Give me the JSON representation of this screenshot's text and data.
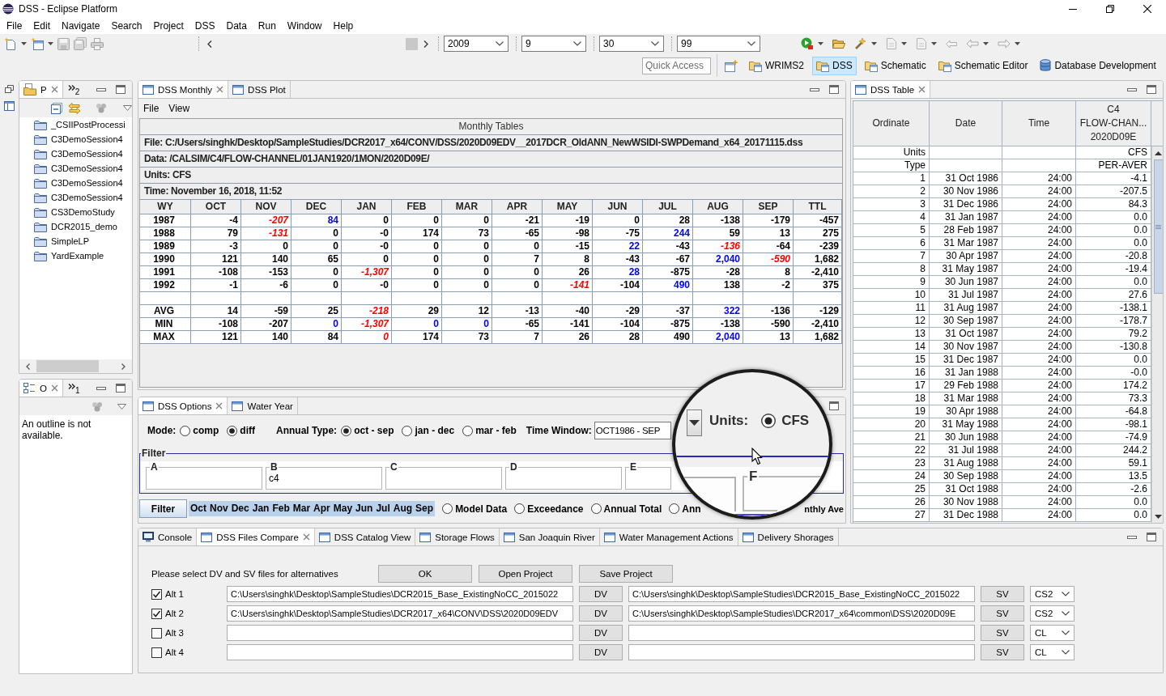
{
  "window": {
    "title": "DSS - Eclipse Platform"
  },
  "menu": [
    "File",
    "Edit",
    "Navigate",
    "Search",
    "Project",
    "DSS",
    "Data",
    "Run",
    "Window",
    "Help"
  ],
  "toolbar": {
    "combos": [
      "2009",
      "9",
      "30",
      "99"
    ],
    "quick_access": {
      "placeholder": "Quick Access"
    },
    "perspectives": [
      {
        "label": "WRIMS2",
        "kind": "folder",
        "selected": false
      },
      {
        "label": "DSS",
        "kind": "folder",
        "selected": true
      },
      {
        "label": "Schematic",
        "kind": "folder",
        "selected": false
      },
      {
        "label": "Schematic Editor",
        "kind": "folder",
        "selected": false
      },
      {
        "label": "Database Development",
        "kind": "database",
        "selected": false
      }
    ]
  },
  "project_explorer": {
    "tabs": [
      {
        "label": "P",
        "kind": "project",
        "selected": true
      }
    ],
    "overflow": "2",
    "items": [
      "_CSIIPostProcessi",
      "C3DemoSession4",
      "C3DemoSession4",
      "C3DemoSession4",
      "C3DemoSession4",
      "C3DemoSession4",
      "CS3DemoStudy",
      "DCR2015_demo",
      "SimpleLP",
      "YardExample"
    ]
  },
  "outline": {
    "tabs": [
      {
        "label": "O",
        "kind": "outline",
        "selected": true
      }
    ],
    "overflow": "1",
    "message": "An outline is not available."
  },
  "monthly": {
    "tabs": [
      {
        "label": "DSS Monthly",
        "kind": "view",
        "selected": true
      },
      {
        "label": "DSS Plot",
        "kind": "view",
        "selected": false
      }
    ],
    "menu": [
      "File",
      "View"
    ],
    "caption": "Monthly Tables",
    "info": [
      "File: C:/Users/singhk/Desktop/SampleStudies/DCR2017_x64/CONV/DSS/2020D09EDV__2017DCR_OldANN_NewWSIDI-SWPDemand_x64_20171115.dss",
      "Data: /CALSIM/C4/FLOW-CHANNEL/01JAN1920/1MON/2020D09E/",
      "Units: CFS",
      "Time: November 16, 2018, 11:52"
    ],
    "columns": [
      "WY",
      "OCT",
      "NOV",
      "DEC",
      "JAN",
      "FEB",
      "MAR",
      "APR",
      "MAY",
      "JUN",
      "JUL",
      "AUG",
      "SEP",
      "TTL"
    ],
    "rows": [
      {
        "kind": "values",
        "label": "1987",
        "cells": [
          {
            "text": "-4",
            "kind": "plain"
          },
          {
            "text": "-207",
            "kind": "low"
          },
          {
            "text": "84",
            "kind": "high"
          },
          {
            "text": "0",
            "kind": "plain"
          },
          {
            "text": "0",
            "kind": "plain"
          },
          {
            "text": "0",
            "kind": "plain"
          },
          {
            "text": "-21",
            "kind": "plain"
          },
          {
            "text": "-19",
            "kind": "plain"
          },
          {
            "text": "0",
            "kind": "plain"
          },
          {
            "text": "28",
            "kind": "plain"
          },
          {
            "text": "-138",
            "kind": "plain"
          },
          {
            "text": "-179",
            "kind": "plain"
          },
          {
            "text": "-457",
            "kind": "plain"
          }
        ]
      },
      {
        "kind": "values",
        "label": "1988",
        "cells": [
          {
            "text": "79",
            "kind": "plain"
          },
          {
            "text": "-131",
            "kind": "low"
          },
          {
            "text": "0",
            "kind": "plain"
          },
          {
            "text": "-0",
            "kind": "plain"
          },
          {
            "text": "174",
            "kind": "plain"
          },
          {
            "text": "73",
            "kind": "plain"
          },
          {
            "text": "-65",
            "kind": "plain"
          },
          {
            "text": "-98",
            "kind": "plain"
          },
          {
            "text": "-75",
            "kind": "plain"
          },
          {
            "text": "244",
            "kind": "high"
          },
          {
            "text": "59",
            "kind": "plain"
          },
          {
            "text": "13",
            "kind": "plain"
          },
          {
            "text": "275",
            "kind": "plain"
          }
        ]
      },
      {
        "kind": "values",
        "label": "1989",
        "cells": [
          {
            "text": "-3",
            "kind": "plain"
          },
          {
            "text": "0",
            "kind": "plain"
          },
          {
            "text": "0",
            "kind": "plain"
          },
          {
            "text": "-0",
            "kind": "plain"
          },
          {
            "text": "0",
            "kind": "plain"
          },
          {
            "text": "0",
            "kind": "plain"
          },
          {
            "text": "0",
            "kind": "plain"
          },
          {
            "text": "-15",
            "kind": "plain"
          },
          {
            "text": "22",
            "kind": "high"
          },
          {
            "text": "-43",
            "kind": "plain"
          },
          {
            "text": "-136",
            "kind": "low"
          },
          {
            "text": "-64",
            "kind": "plain"
          },
          {
            "text": "-239",
            "kind": "plain"
          }
        ]
      },
      {
        "kind": "values",
        "label": "1990",
        "cells": [
          {
            "text": "121",
            "kind": "plain"
          },
          {
            "text": "140",
            "kind": "plain"
          },
          {
            "text": "65",
            "kind": "plain"
          },
          {
            "text": "0",
            "kind": "plain"
          },
          {
            "text": "0",
            "kind": "plain"
          },
          {
            "text": "0",
            "kind": "plain"
          },
          {
            "text": "7",
            "kind": "plain"
          },
          {
            "text": "8",
            "kind": "plain"
          },
          {
            "text": "-43",
            "kind": "plain"
          },
          {
            "text": "-67",
            "kind": "plain"
          },
          {
            "text": "2,040",
            "kind": "high"
          },
          {
            "text": "-590",
            "kind": "low"
          },
          {
            "text": "1,682",
            "kind": "plain"
          }
        ]
      },
      {
        "kind": "values",
        "label": "1991",
        "cells": [
          {
            "text": "-108",
            "kind": "plain"
          },
          {
            "text": "-153",
            "kind": "plain"
          },
          {
            "text": "0",
            "kind": "plain"
          },
          {
            "text": "-1,307",
            "kind": "low"
          },
          {
            "text": "0",
            "kind": "plain"
          },
          {
            "text": "0",
            "kind": "plain"
          },
          {
            "text": "0",
            "kind": "plain"
          },
          {
            "text": "26",
            "kind": "plain"
          },
          {
            "text": "28",
            "kind": "high"
          },
          {
            "text": "-875",
            "kind": "plain"
          },
          {
            "text": "-28",
            "kind": "plain"
          },
          {
            "text": "8",
            "kind": "plain"
          },
          {
            "text": "-2,410",
            "kind": "plain"
          }
        ]
      },
      {
        "kind": "values",
        "label": "1992",
        "cells": [
          {
            "text": "-1",
            "kind": "plain"
          },
          {
            "text": "-6",
            "kind": "plain"
          },
          {
            "text": "0",
            "kind": "plain"
          },
          {
            "text": "-0",
            "kind": "plain"
          },
          {
            "text": "0",
            "kind": "plain"
          },
          {
            "text": "0",
            "kind": "plain"
          },
          {
            "text": "0",
            "kind": "plain"
          },
          {
            "text": "-141",
            "kind": "low"
          },
          {
            "text": "-104",
            "kind": "plain"
          },
          {
            "text": "490",
            "kind": "high"
          },
          {
            "text": "138",
            "kind": "plain"
          },
          {
            "text": "-2",
            "kind": "plain"
          },
          {
            "text": "375",
            "kind": "plain"
          }
        ]
      },
      {
        "kind": "spacer"
      },
      {
        "kind": "values",
        "label": "AVG",
        "cells": [
          {
            "text": "14",
            "kind": "plain"
          },
          {
            "text": "-59",
            "kind": "plain"
          },
          {
            "text": "25",
            "kind": "plain"
          },
          {
            "text": "-218",
            "kind": "low"
          },
          {
            "text": "29",
            "kind": "plain"
          },
          {
            "text": "12",
            "kind": "plain"
          },
          {
            "text": "-13",
            "kind": "plain"
          },
          {
            "text": "-40",
            "kind": "plain"
          },
          {
            "text": "-29",
            "kind": "plain"
          },
          {
            "text": "-37",
            "kind": "plain"
          },
          {
            "text": "322",
            "kind": "high"
          },
          {
            "text": "-136",
            "kind": "plain"
          },
          {
            "text": "-129",
            "kind": "plain"
          }
        ]
      },
      {
        "kind": "values",
        "label": "MIN",
        "cells": [
          {
            "text": "-108",
            "kind": "plain"
          },
          {
            "text": "-207",
            "kind": "plain"
          },
          {
            "text": "0",
            "kind": "high"
          },
          {
            "text": "-1,307",
            "kind": "low"
          },
          {
            "text": "0",
            "kind": "high"
          },
          {
            "text": "0",
            "kind": "high"
          },
          {
            "text": "-65",
            "kind": "plain"
          },
          {
            "text": "-141",
            "kind": "plain"
          },
          {
            "text": "-104",
            "kind": "plain"
          },
          {
            "text": "-875",
            "kind": "plain"
          },
          {
            "text": "-138",
            "kind": "plain"
          },
          {
            "text": "-590",
            "kind": "plain"
          },
          {
            "text": "-2,410",
            "kind": "plain"
          }
        ]
      },
      {
        "kind": "values",
        "label": "MAX",
        "cells": [
          {
            "text": "121",
            "kind": "plain"
          },
          {
            "text": "140",
            "kind": "plain"
          },
          {
            "text": "84",
            "kind": "plain"
          },
          {
            "text": "0",
            "kind": "low"
          },
          {
            "text": "174",
            "kind": "plain"
          },
          {
            "text": "73",
            "kind": "plain"
          },
          {
            "text": "7",
            "kind": "plain"
          },
          {
            "text": "26",
            "kind": "plain"
          },
          {
            "text": "28",
            "kind": "plain"
          },
          {
            "text": "490",
            "kind": "plain"
          },
          {
            "text": "2,040",
            "kind": "high"
          },
          {
            "text": "13",
            "kind": "plain"
          },
          {
            "text": "1,682",
            "kind": "plain"
          }
        ]
      }
    ]
  },
  "options": {
    "tabs": [
      {
        "label": "DSS Options",
        "kind": "view",
        "selected": true
      },
      {
        "label": "Water Year",
        "kind": "view",
        "selected": false
      }
    ],
    "mode": {
      "label": "Mode:",
      "choices": [
        {
          "label": "comp",
          "selected": false
        },
        {
          "label": "diff",
          "selected": true
        }
      ]
    },
    "annual_type": {
      "label": "Annual Type:",
      "choices": [
        {
          "label": "oct - sep",
          "selected": true
        },
        {
          "label": "jan - dec",
          "selected": false
        },
        {
          "label": "mar - feb",
          "selected": false
        }
      ]
    },
    "time_window": {
      "label": "Time Window:",
      "value": "OCT1986 - SEP"
    },
    "filter": {
      "title": "Filter",
      "fields": [
        {
          "label": "A"
        },
        {
          "label": "B",
          "value": "c4"
        },
        {
          "label": "C"
        },
        {
          "label": "D"
        },
        {
          "label": "E"
        }
      ]
    },
    "filter_button": "Filter",
    "months": [
      {
        "label": "Oct",
        "selected": true
      },
      {
        "label": "Nov",
        "selected": true
      },
      {
        "label": "Dec",
        "selected": true
      },
      {
        "label": "Jan",
        "selected": true
      },
      {
        "label": "Feb",
        "selected": true
      },
      {
        "label": "Mar",
        "selected": true
      },
      {
        "label": "Apr",
        "selected": true
      },
      {
        "label": "May",
        "selected": true
      },
      {
        "label": "Jun",
        "selected": true
      },
      {
        "label": "Jul",
        "selected": true
      },
      {
        "label": "Aug",
        "selected": true
      },
      {
        "label": "Sep",
        "selected": true
      }
    ],
    "views": [
      {
        "label": "Model Data",
        "selected": false
      },
      {
        "label": "Exceedance",
        "selected": false
      },
      {
        "label": "Annual Total",
        "selected": false
      },
      {
        "label": "Ann",
        "selected": false
      }
    ],
    "trailing_label": "nthly Ave"
  },
  "magnifier": {
    "units_label": "Units:",
    "units_options": [
      {
        "label": "CFS",
        "selected": true
      }
    ],
    "field_label": "F"
  },
  "dss_table": {
    "tabs": [
      {
        "label": "DSS Table",
        "kind": "view",
        "selected": true
      }
    ],
    "columns": [
      "Ordinate",
      "Date",
      "Time",
      "C4\nFLOW-CHAN...\n2020D09E"
    ],
    "meta_rows": [
      {
        "label": "Units",
        "value": "CFS"
      },
      {
        "label": "Type",
        "value": "PER-AVER"
      }
    ],
    "rows": [
      [
        "1",
        "31 Oct 1986",
        "24:00",
        "-4.1"
      ],
      [
        "2",
        "30 Nov 1986",
        "24:00",
        "-207.5"
      ],
      [
        "3",
        "31 Dec 1986",
        "24:00",
        "84.3"
      ],
      [
        "4",
        "31 Jan 1987",
        "24:00",
        "0.0"
      ],
      [
        "5",
        "28 Feb 1987",
        "24:00",
        "0.0"
      ],
      [
        "6",
        "31 Mar 1987",
        "24:00",
        "0.0"
      ],
      [
        "7",
        "30 Apr 1987",
        "24:00",
        "-20.8"
      ],
      [
        "8",
        "31 May 1987",
        "24:00",
        "-19.4"
      ],
      [
        "9",
        "30 Jun 1987",
        "24:00",
        "0.0"
      ],
      [
        "10",
        "31 Jul 1987",
        "24:00",
        "27.6"
      ],
      [
        "11",
        "31 Aug 1987",
        "24:00",
        "-138.1"
      ],
      [
        "12",
        "30 Sep 1987",
        "24:00",
        "-178.7"
      ],
      [
        "13",
        "31 Oct 1987",
        "24:00",
        "79.2"
      ],
      [
        "14",
        "30 Nov 1987",
        "24:00",
        "-130.8"
      ],
      [
        "15",
        "31 Dec 1987",
        "24:00",
        "0.0"
      ],
      [
        "16",
        "31 Jan 1988",
        "24:00",
        "-0.0"
      ],
      [
        "17",
        "29 Feb 1988",
        "24:00",
        "174.2"
      ],
      [
        "18",
        "31 Mar 1988",
        "24:00",
        "73.3"
      ],
      [
        "19",
        "30 Apr 1988",
        "24:00",
        "-64.8"
      ],
      [
        "20",
        "31 May 1988",
        "24:00",
        "-98.1"
      ],
      [
        "21",
        "30 Jun 1988",
        "24:00",
        "-74.9"
      ],
      [
        "22",
        "31 Jul 1988",
        "24:00",
        "244.2"
      ],
      [
        "23",
        "31 Aug 1988",
        "24:00",
        "59.1"
      ],
      [
        "24",
        "30 Sep 1988",
        "24:00",
        "13.5"
      ],
      [
        "25",
        "31 Oct 1988",
        "24:00",
        "-2.6"
      ],
      [
        "26",
        "30 Nov 1988",
        "24:00",
        "0.0"
      ],
      [
        "27",
        "31 Dec 1988",
        "24:00",
        "0.0"
      ]
    ]
  },
  "files_compare": {
    "tabs": [
      {
        "label": "Console",
        "kind": "console",
        "selected": false
      },
      {
        "label": "DSS Files Compare",
        "kind": "view",
        "selected": true
      },
      {
        "label": "DSS Catalog View",
        "kind": "view",
        "selected": false
      },
      {
        "label": "Storage Flows",
        "kind": "view",
        "selected": false
      },
      {
        "label": "San Joaquin River",
        "kind": "view",
        "selected": false
      },
      {
        "label": "Water Management Actions",
        "kind": "view",
        "selected": false
      },
      {
        "label": "Delivery Shorages",
        "kind": "view",
        "selected": false
      }
    ],
    "prompt": "Please select DV and SV files for alternatives",
    "buttons": [
      "OK",
      "Open Project",
      "Save Project"
    ],
    "alternatives": [
      {
        "label": "Alt 1",
        "checked": true,
        "dv_path": "C:\\Users\\singhk\\Desktop\\SampleStudies\\DCR2015_Base_ExistingNoCC_2015022",
        "dv_button": "DV",
        "sv_path": "C:\\Users\\singhk\\Desktop\\SampleStudies\\DCR2015_Base_ExistingNoCC_2015022",
        "sv_button": "SV",
        "scenario": "CS2"
      },
      {
        "label": "Alt 2",
        "checked": true,
        "dv_path": "C:\\Users\\singhk\\Desktop\\SampleStudies\\DCR2017_x64\\CONV\\DSS\\2020D09EDV",
        "dv_button": "DV",
        "sv_path": "C:\\Users\\singhk\\Desktop\\SampleStudies\\DCR2017_x64\\common\\DSS\\2020D09E",
        "sv_button": "SV",
        "scenario": "CS2"
      },
      {
        "label": "Alt 3",
        "checked": false,
        "dv_button": "DV",
        "sv_button": "SV",
        "scenario": "CL"
      },
      {
        "label": "Alt 4",
        "checked": false,
        "dv_button": "DV",
        "sv_button": "SV",
        "scenario": "CL"
      }
    ]
  }
}
